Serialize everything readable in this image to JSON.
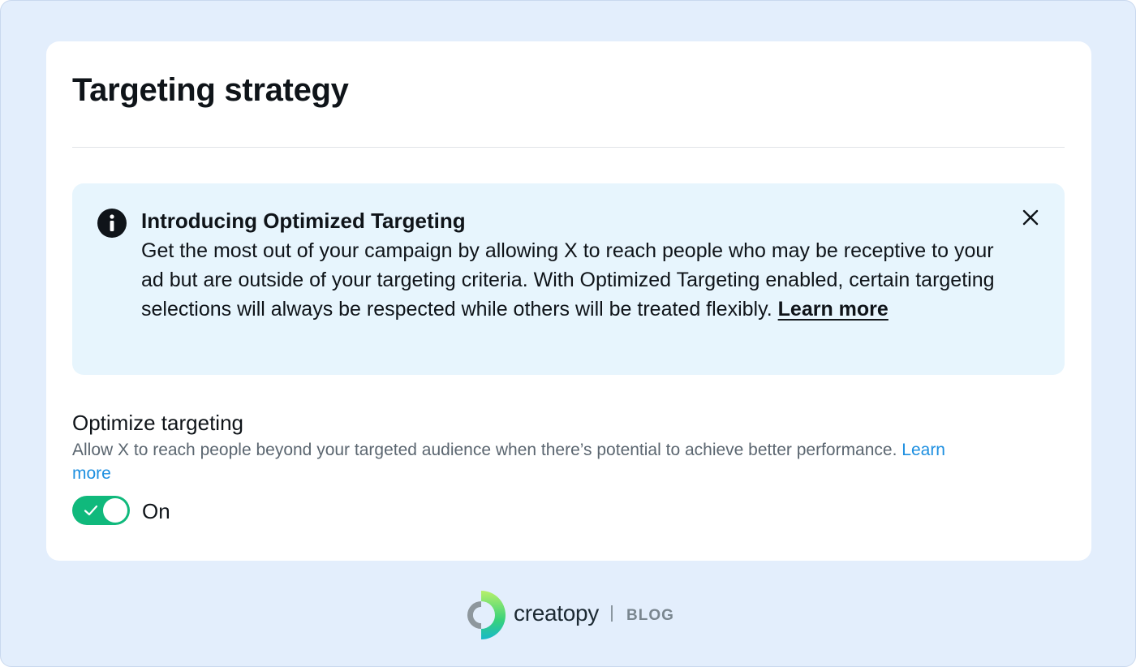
{
  "card": {
    "title": "Targeting strategy"
  },
  "banner": {
    "icon": "info-icon",
    "title": "Introducing Optimized Targeting",
    "body": "Get the most out of your campaign by allowing X to reach people who may be receptive to your ad but are outside of your targeting criteria. With Optimized Targeting enabled, certain targeting selections will always be respected while others will be treated flexibly.",
    "link_label": "Learn more",
    "close_icon": "close-icon"
  },
  "optimize": {
    "label": "Optimize targeting",
    "description": "Allow X to reach people beyond your targeted audience when there’s potential to achieve better performance.",
    "link_label": "Learn more",
    "toggle_state": "On",
    "toggle_on": true
  },
  "footer": {
    "brand": "creatopy",
    "separator": "|",
    "tag": "BLOG"
  },
  "colors": {
    "background": "#e3eefc",
    "card": "#ffffff",
    "banner": "#e7f5fd",
    "toggle_on": "#10b97c",
    "link": "#1d8fe0",
    "text": "#0f1419",
    "muted_text": "#5b6670"
  }
}
